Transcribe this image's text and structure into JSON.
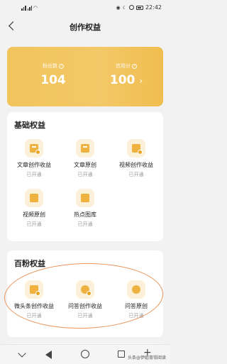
{
  "status_bar": {
    "time": "22:42",
    "icons": [
      "signal-icon",
      "wifi-icon",
      "eye-icon",
      "moon-icon",
      "alarm-icon",
      "battery-icon"
    ]
  },
  "nav": {
    "title": "创作权益",
    "back_icon": "chevron-left-icon"
  },
  "stats": {
    "fans_label": "粉丝数",
    "fans_value": "104",
    "credit_label": "信用分",
    "credit_value": "100",
    "credit_chevron": "›"
  },
  "basic": {
    "title": "基础权益",
    "items": [
      {
        "name": "文章创作收益",
        "status": "已开通",
        "icon": "article-income-icon"
      },
      {
        "name": "文章原创",
        "status": "已开通",
        "icon": "article-original-icon"
      },
      {
        "name": "视频创作收益",
        "status": "已开通",
        "icon": "video-income-icon"
      },
      {
        "name": "视频原创",
        "status": "已开通",
        "icon": "video-original-icon"
      },
      {
        "name": "热点图库",
        "status": "已开通",
        "icon": "image-library-icon"
      }
    ]
  },
  "fans": {
    "title": "百粉权益",
    "items": [
      {
        "name": "微头条创作收益",
        "status": "已开通",
        "icon": "micro-post-income-icon"
      },
      {
        "name": "问答创作收益",
        "status": "已开通",
        "icon": "qa-income-icon"
      },
      {
        "name": "问答原创",
        "status": "已开通",
        "icon": "qa-original-icon"
      }
    ]
  },
  "watermark": "头条@伊姐育钳阅读",
  "colors": {
    "accent": "#f2c45c",
    "icon_bg": "#fbf1d9",
    "icon_fg": "#efb240",
    "annotation": "#e8955a"
  }
}
